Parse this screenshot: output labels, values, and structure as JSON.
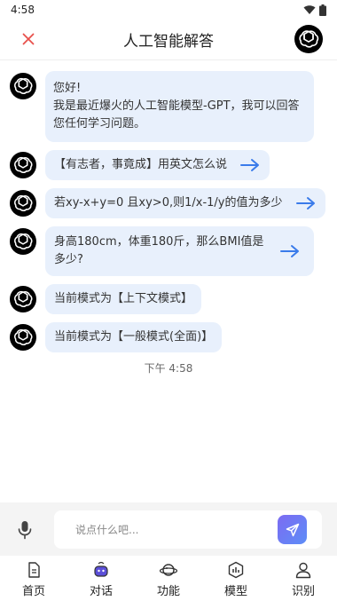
{
  "status_bar": {
    "time": "4:58"
  },
  "header": {
    "title": "人工智能解答"
  },
  "chat": {
    "intro_line1": "您好!",
    "intro_line2": "我是最近爆火的人工智能模型-GPT，我可以回答您任何学习问题。",
    "questions": [
      "【有志者，事竟成】用英文怎么说",
      "若xy-x+y=0 且xy>0,则1/x-1/y的值为多少",
      "身高180cm，体重180斤，那么BMI值是多少?"
    ],
    "mode_messages": [
      "当前模式为【上下文模式】",
      "当前模式为【一般模式(全面)】"
    ],
    "time_label": "下午 4:58"
  },
  "input": {
    "placeholder": "说点什么吧..."
  },
  "tabs": [
    {
      "label": "首页",
      "icon": "document-icon"
    },
    {
      "label": "对话",
      "icon": "chat-robot-icon"
    },
    {
      "label": "功能",
      "icon": "planet-icon"
    },
    {
      "label": "模型",
      "icon": "model-icon"
    },
    {
      "label": "识别",
      "icon": "user-icon"
    }
  ],
  "colors": {
    "accent_blue": "#3a7bea",
    "bubble_bg": "#e8f0fc",
    "close_red": "#e8504c",
    "send_gradient_start": "#7c6bf2",
    "send_gradient_end": "#5d8df7"
  }
}
